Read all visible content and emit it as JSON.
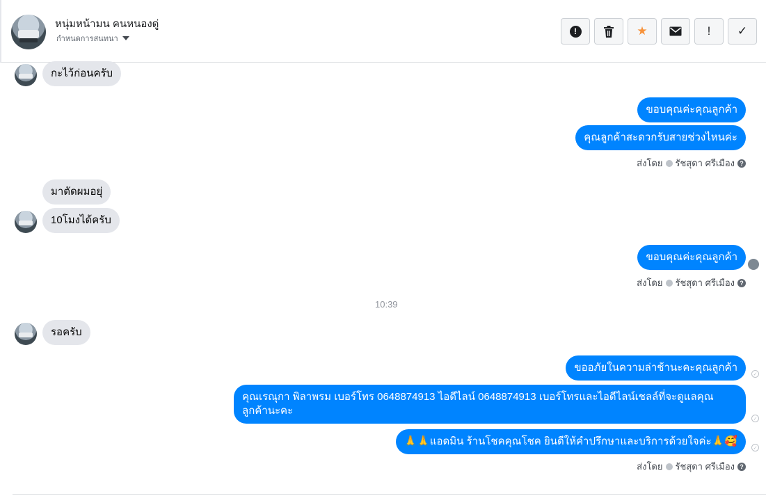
{
  "header": {
    "contact_name": "หนุ่มหน้ามน คนหนองดู่",
    "conversation_setting": "กำหนดการสนทนา",
    "actions": [
      {
        "name": "report-spam-icon",
        "glyph": "!"
      },
      {
        "name": "trash-icon",
        "glyph": "🗑"
      },
      {
        "name": "star-icon",
        "glyph": "★"
      },
      {
        "name": "mail-icon",
        "glyph": "✉"
      },
      {
        "name": "mark-important-icon",
        "glyph": "!"
      },
      {
        "name": "done-check-icon",
        "glyph": "✓"
      }
    ],
    "star_color": "#f7923a"
  },
  "colors": {
    "outgoing_bubble": "#0084ff",
    "incoming_bubble": "#e4e6eb"
  },
  "messages": {
    "m1": "กะไว้ก่อนครับ",
    "m2": "ขอบคุณค่ะคุณลูกค้า",
    "m3": "คุณลูกค้าสะดวกรับสายช่วงไหนค่ะ",
    "sent_by_1": "ส่งโดย",
    "sender_1": "รัชสุดา ศรีเมือง",
    "m4": "มาตัดผมอยุ่",
    "m5": "10โมงได้ครับ",
    "m6": "ขอบคุณค่ะคุณลูกค้า",
    "sent_by_2": "ส่งโดย",
    "sender_2": "รัชสุดา ศรีเมือง",
    "time_1": "10:39",
    "m7": "รอครับ",
    "m8": "ขออภัยในความล่าช้านะคะคุณลูกค้า",
    "m9": "คุณเรณุกา พิลาพรม        เบอร์โทร 0648874913  ไอดีไลน์ 0648874913   เบอร์โทรและไอดีไลน์เชลล์ที่จะดูแลคุณลูกค้านะคะ",
    "m10": "🙏🙏แอดมิน ร้านโชคคุณโชค ยินดีให้คำปรึกษาและบริการด้วยใจค่ะ🙏🥰",
    "sent_by_3": "ส่งโดย",
    "sender_3": "รัชสุดา ศรีเมือง"
  }
}
